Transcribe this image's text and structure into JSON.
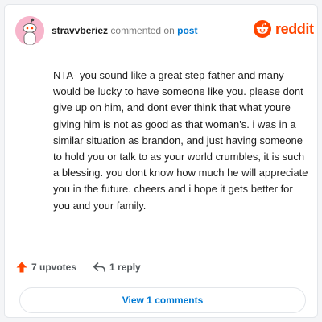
{
  "header": {
    "username": "stravvberiez",
    "action_text": "commented on",
    "post_link": "post",
    "brand": "reddit"
  },
  "comment": {
    "body": "NTA- you sound like a great step-father and many would be lucky to have someone like you. please dont give up on him, and dont ever think that what youre giving him is not as good as that woman's. i was in a similar situation as brandon, and just having someone to hold you or talk to as your world crumbles, it is such a blessing. you dont know how much he will appreciate you in the future. cheers and i hope it gets better for you and your family."
  },
  "actions": {
    "upvotes": "7 upvotes",
    "replies": "1 reply"
  },
  "footer": {
    "view_comments": "View 1 comments"
  },
  "icons": {
    "avatar": "snoo-avatar-icon",
    "brand": "reddit-logo-icon",
    "upvote": "upvote-arrow-icon",
    "reply": "reply-arrow-icon"
  },
  "colors": {
    "accent": "#ff4500",
    "link": "#0079d3",
    "avatar_bg": "#f7b5cb",
    "text": "#1c1c1c",
    "muted": "#7c7c7c"
  }
}
